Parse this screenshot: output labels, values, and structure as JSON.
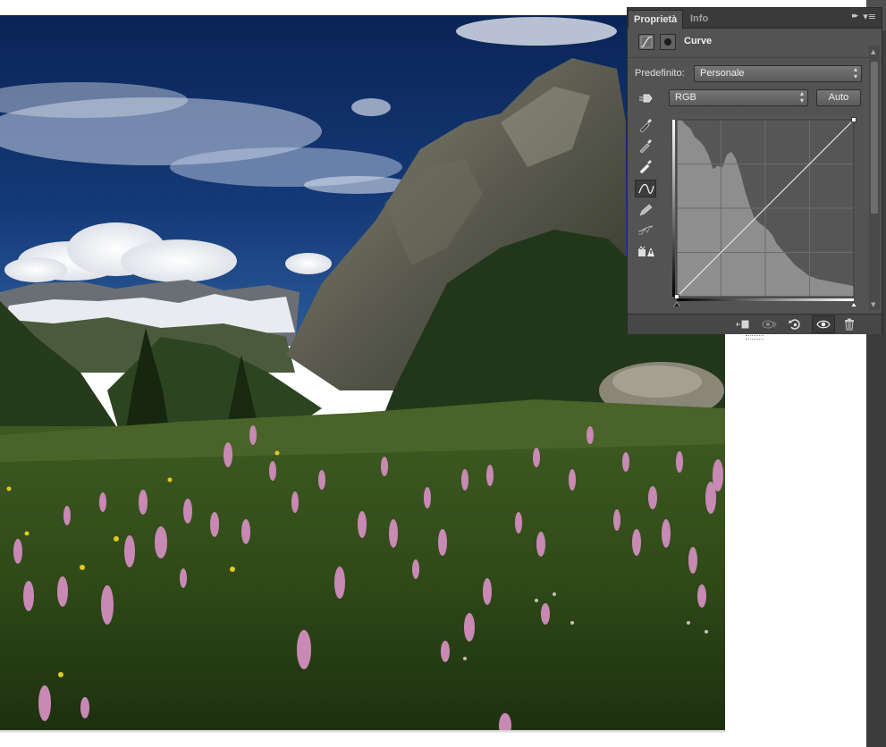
{
  "panel": {
    "tabs": [
      {
        "label": "Proprietà",
        "active": true
      },
      {
        "label": "Info",
        "active": false
      }
    ],
    "title": "Curve",
    "preset_label": "Predefinito:",
    "preset_value": "Personale",
    "channel_value": "RGB",
    "auto_label": "Auto",
    "collapse_glyph": "▸▸",
    "menu_glyph": "▾≡",
    "header_icons": [
      "curves-adjustment-icon",
      "layer-mask-icon"
    ],
    "tools": [
      "on-image-adjust-icon",
      "black-point-eyedropper-icon",
      "gray-point-eyedropper-icon",
      "white-point-eyedropper-icon",
      "curve-point-tool-icon",
      "pencil-draw-icon",
      "smooth-curve-icon",
      "clipping-warning-icon"
    ],
    "bottom_icons": [
      "clip-to-layer-icon",
      "view-previous-state-icon",
      "reset-icon",
      "visibility-eye-icon",
      "trash-icon"
    ],
    "curve": {
      "points": [
        [
          0,
          0
        ],
        [
          255,
          255
        ]
      ],
      "grid_divisions": 4,
      "histogram": "shown"
    },
    "colors": {
      "panel_bg": "#535353",
      "tab_bar": "#3a3a3a",
      "text": "#dcdcdc"
    }
  },
  "canvas": {
    "content": "alpine meadow photograph"
  }
}
